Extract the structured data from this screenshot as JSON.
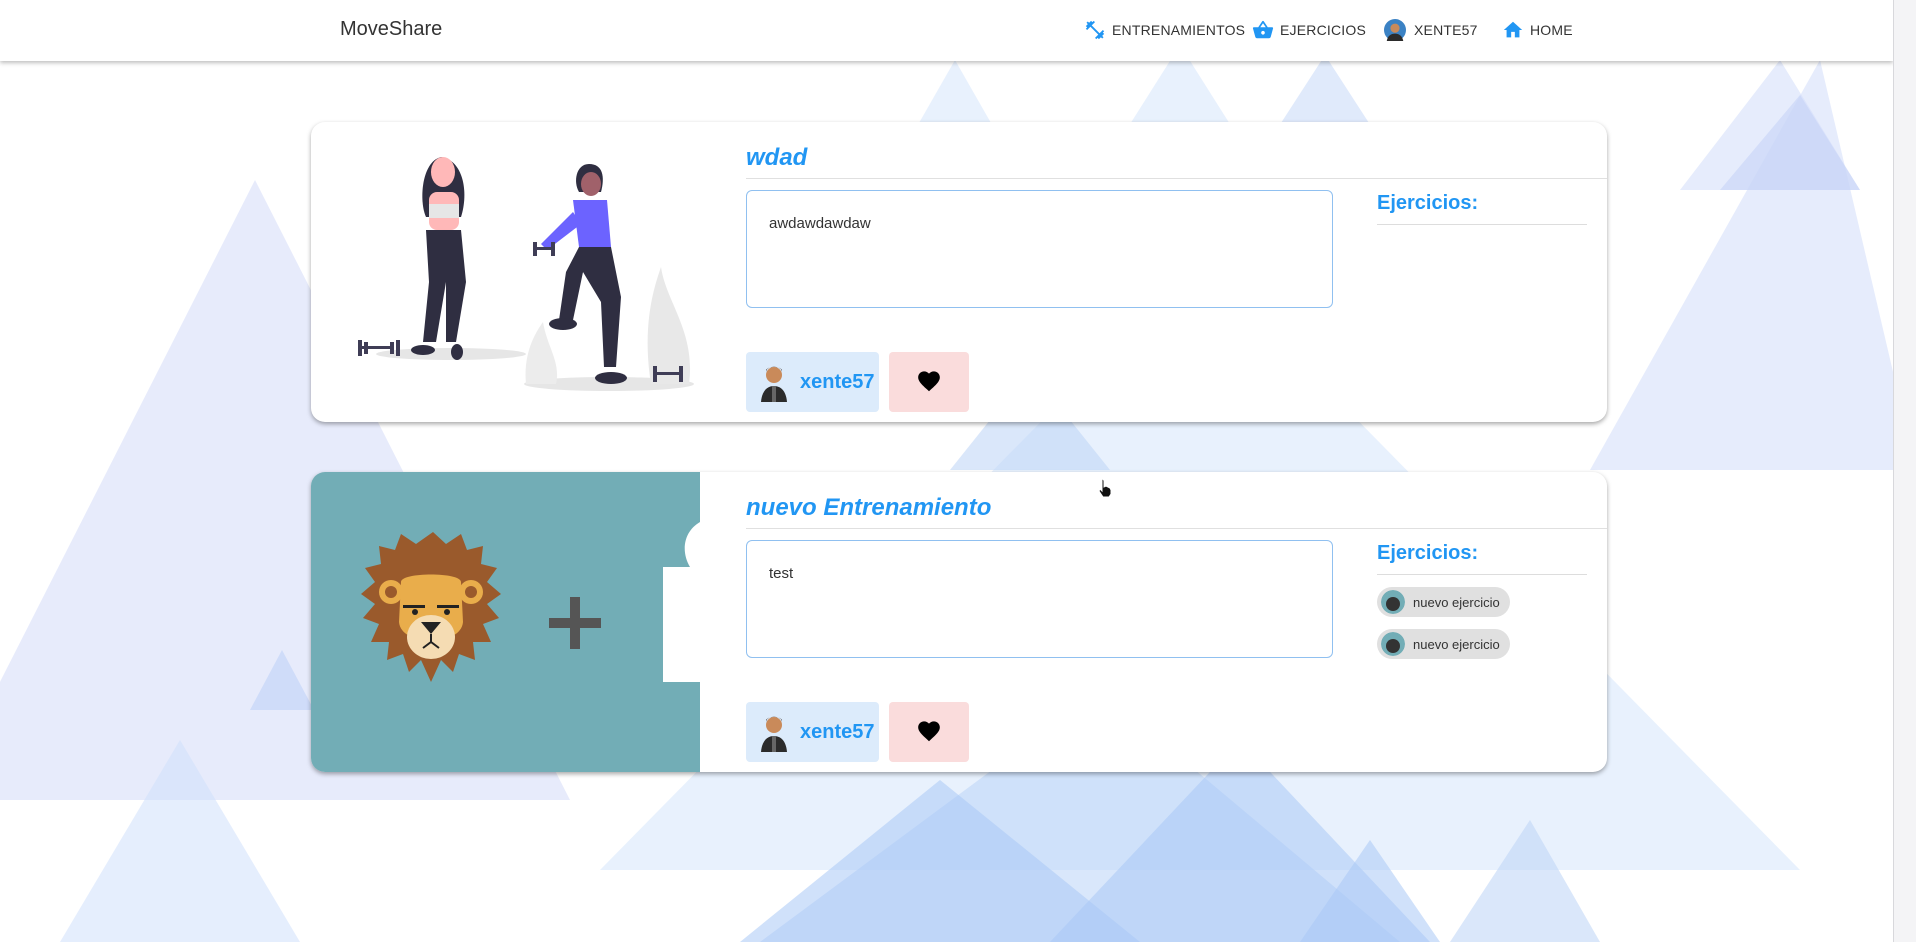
{
  "app": {
    "brand": "MoveShare"
  },
  "nav": {
    "items": [
      {
        "label": "ENTRENAMIENTOS",
        "icon": "fitness-icon"
      },
      {
        "label": "EJERCICIOS",
        "icon": "basket-icon"
      },
      {
        "label": "XENTE57",
        "icon": "avatar"
      },
      {
        "label": "HOME",
        "icon": "home-icon"
      }
    ]
  },
  "colors": {
    "accent": "#2196f3",
    "like_bg": "#fadcdc",
    "user_bg": "#dcebfb",
    "lion_bg": "#72adb6"
  },
  "workouts": [
    {
      "title": "wdad",
      "description": "awdawdawdaw",
      "exercises_label": "Ejercicios:",
      "exercises": [],
      "user": "xente57",
      "image": "people-exercising-illustration"
    },
    {
      "title": "nuevo Entrenamiento",
      "description": "test",
      "exercises_label": "Ejercicios:",
      "exercises": [
        "nuevo ejercicio",
        "nuevo ejercicio"
      ],
      "user": "xente57",
      "image": "lion-plus-placeholder"
    }
  ]
}
